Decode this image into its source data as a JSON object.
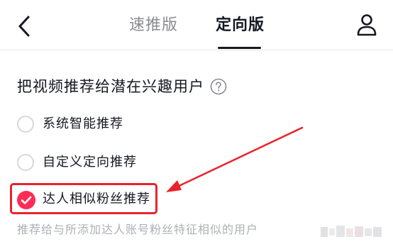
{
  "header": {
    "back_icon": "chevron-left-icon",
    "tabs": [
      {
        "label": "速推版",
        "active": false
      },
      {
        "label": "定向版",
        "active": true
      }
    ],
    "user_icon": "user-icon"
  },
  "section": {
    "title": "把视频推荐给潜在兴趣用户",
    "help_icon": "question-circle-icon"
  },
  "options": [
    {
      "label": "系统智能推荐",
      "checked": false
    },
    {
      "label": "自定义定向推荐",
      "checked": false
    },
    {
      "label": "达人相似粉丝推荐",
      "checked": true
    }
  ],
  "description": "推荐给与所添加达人账号粉丝特征相似的用户",
  "colors": {
    "text_primary": "#161823",
    "text_secondary": "#8a8b91",
    "text_hint": "#aeb0b6",
    "accent_red": "#fe2c55",
    "annotation_red": "#e8232c"
  }
}
